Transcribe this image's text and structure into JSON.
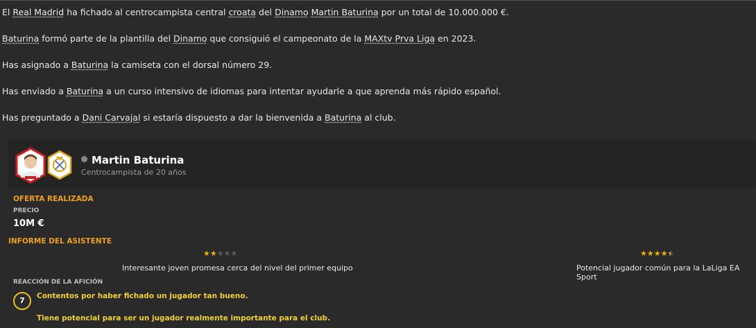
{
  "news": {
    "line1": {
      "p1": "El ",
      "club": "Real Madrid",
      "p2": " ha fichado al centrocampista central ",
      "nat": "croata",
      "p3": " del ",
      "from": "Dinamo",
      "p4": " ",
      "player": "Martin Baturina",
      "p5": " por un total de 10.000.000 €."
    },
    "line2": {
      "player": "Baturina",
      "p1": " formó parte de la plantilla del ",
      "club": "Dinamo",
      "p2": " que consiguió el campeonato de la ",
      "league": "MAXtv Prva Liga",
      "p3": " en 2023."
    },
    "line3": {
      "p1": "Has asignado a ",
      "player": "Baturina",
      "p2": " la camiseta con el dorsal número 29."
    },
    "line4": {
      "p1": "Has enviado a ",
      "player": "Baturina",
      "p2": " a un curso intensivo de idiomas para intentar ayudarle a que aprenda más rápido español."
    },
    "line5": {
      "p1": "Has preguntado a ",
      "other": "Dani Carvajal",
      "p2": " si estaría dispuesto a dar la bienvenida a ",
      "player": "Baturina",
      "p3": " al club."
    }
  },
  "player_card": {
    "name": "Martin Baturina",
    "subtitle": "Centrocampista de 20 años",
    "icons": {
      "portrait": "player-portrait-icon",
      "crest": "club-crest-icon",
      "person": "person-icon"
    }
  },
  "offer": {
    "heading": "OFERTA REALIZADA",
    "price_label": "PRECIO",
    "price_value": "10M €"
  },
  "assistant": {
    "heading": "INFORME DEL ASISTENTE",
    "current": {
      "stars": 2,
      "max": 5,
      "text": "Interesante joven promesa cerca del nivel del primer equipo"
    },
    "potential": {
      "stars": 4.5,
      "max": 5,
      "text": "Potencial jugador común para la LaLiga EA Sport"
    }
  },
  "fans": {
    "label": "REACCIÓN DE LA AFICIÓN",
    "score": "7",
    "line1": "Contentos por haber fichado un jugador tan bueno.",
    "line2": "Tiene potencial para ser un jugador realmente importante para el club."
  },
  "colors": {
    "accent": "#f0a020",
    "star": "#f0b20a",
    "fan": "#f0d03a",
    "background": "#2a2a2a",
    "card": "#242424"
  }
}
